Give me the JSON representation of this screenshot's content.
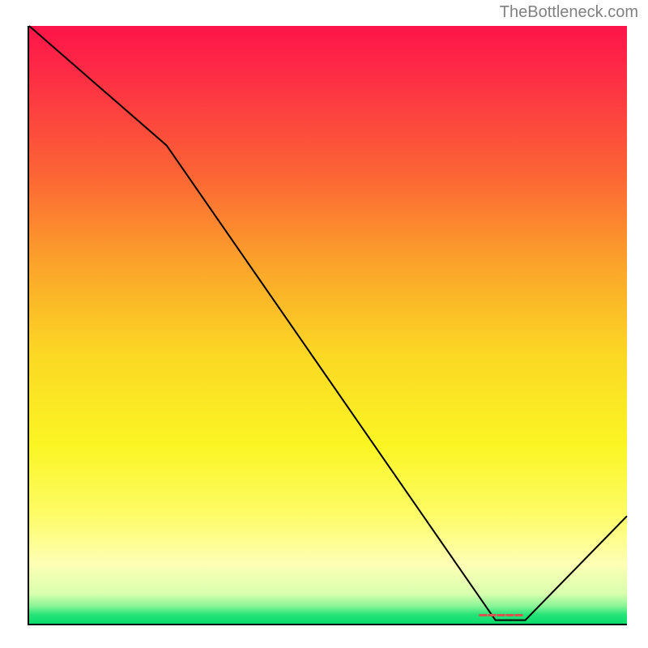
{
  "watermark": "TheBottleneck.com",
  "chart_data": {
    "type": "line",
    "title": "",
    "xlabel": "",
    "ylabel": "",
    "xlim": [
      0,
      100
    ],
    "ylim": [
      0,
      100
    ],
    "grid": false,
    "series": [
      {
        "name": "curve",
        "x": [
          0,
          23,
          78,
          83,
          100
        ],
        "values": [
          100,
          80,
          0.6,
          0.6,
          18
        ]
      }
    ],
    "annotations": [
      {
        "name": "marker",
        "text": "▬▬▬▬▬",
        "x": 80,
        "y": 1.5
      }
    ],
    "colors": {
      "line": "#000000",
      "gradient_top": "#fd1449",
      "gradient_mid": "#fbd824",
      "gradient_bottom": "#08dd6c",
      "marker": "#d9534f"
    }
  }
}
